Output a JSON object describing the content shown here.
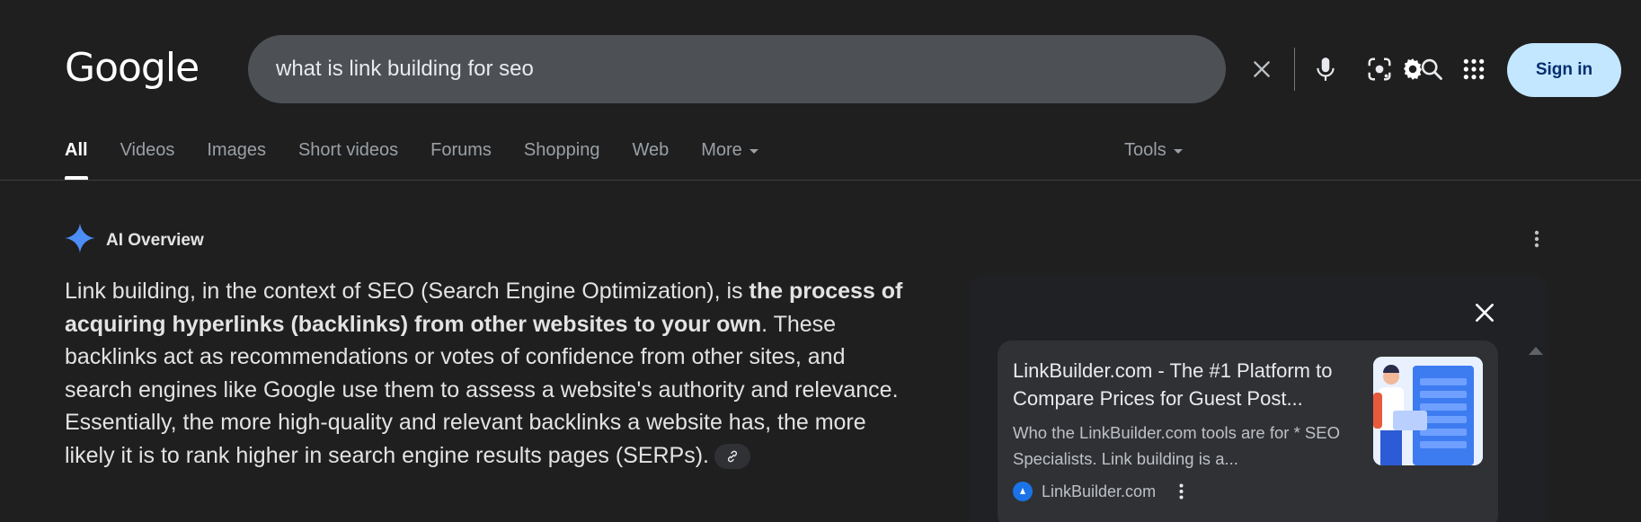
{
  "header": {
    "logo": "Google",
    "search_query": "what is link building for seo",
    "signin_label": "Sign in",
    "icons": [
      "close-icon",
      "mic-icon",
      "lens-icon",
      "search-icon",
      "gear-icon",
      "apps-grid-icon"
    ]
  },
  "tabs": [
    {
      "label": "All",
      "active": true
    },
    {
      "label": "Videos"
    },
    {
      "label": "Images"
    },
    {
      "label": "Short videos"
    },
    {
      "label": "Forums"
    },
    {
      "label": "Shopping"
    },
    {
      "label": "Web"
    },
    {
      "label": "More"
    }
  ],
  "tools_label": "Tools",
  "ai_overview": {
    "title": "AI Overview",
    "text_before": "Link building, in the context of SEO (Search Engine Optimization), is ",
    "text_bold": "the process of acquiring hyperlinks (backlinks) from other websites to your own",
    "text_after": ". These backlinks act as recommendations or votes of confidence from other sites, and search engines like Google use them to assess a website's authority and relevance. Essentially, the more high-quality and relevant backlinks a website has, the more likely it is to rank higher in search engine results pages (SERPs)."
  },
  "source_card": {
    "title": "LinkBuilder.com - The #1 Platform to Compare Prices for Guest Post...",
    "description": "Who the LinkBuilder.com tools are for * SEO Specialists. Link building is a...",
    "source_name": "LinkBuilder.com"
  },
  "colors": {
    "background": "#1f1f1f",
    "searchbox": "#4d5156",
    "signin_bg": "#c2e7ff",
    "signin_text": "#062e6f",
    "card_bg": "#303134",
    "gemini_blue": "#4c8df6"
  }
}
